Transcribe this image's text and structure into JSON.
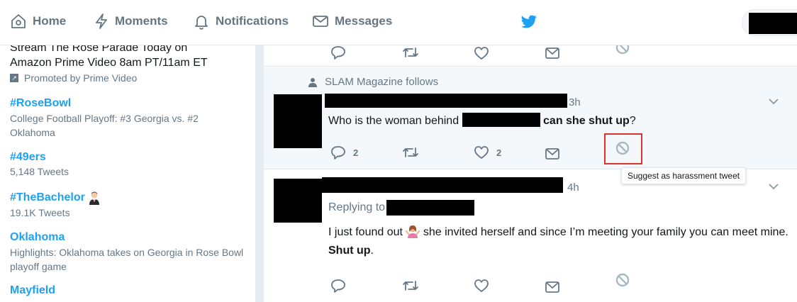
{
  "nav": {
    "home": "Home",
    "moments": "Moments",
    "notifications": "Notifications",
    "messages": "Messages",
    "brand_color": "#1da1f2"
  },
  "sidebar": {
    "promo": {
      "line1": "Stream The Rose Parade Today on",
      "line2": "Amazon Prime Video 8am PT/11am ET",
      "promoted_by": "Promoted by Prime Video"
    },
    "trends": [
      {
        "name": "#RoseBowl",
        "sub": "College Football Playoff: #3 Georgia vs. #2 Oklahoma"
      },
      {
        "name": "#49ers",
        "sub": "5,148 Tweets"
      },
      {
        "name": "#TheBachelor",
        "sub": "19.1K Tweets"
      },
      {
        "name": "Oklahoma",
        "sub": "Highlights: Oklahoma takes on Georgia in Rose Bowl playoff game"
      },
      {
        "name": "Mayfield",
        "sub": ""
      }
    ]
  },
  "feed": {
    "tweet2": {
      "social_context": "SLAM Magazine follows",
      "time": "3h",
      "text_before": "Who is the woman behind",
      "text_bold": "can she shut up",
      "text_after": "?",
      "reply_count": "2",
      "like_count": "2"
    },
    "tooltip": "Suggest as harassment tweet",
    "tweet3": {
      "time": "4h",
      "replying_to": "Replying to",
      "text_part1": "I just found out",
      "text_part2": "she invited herself and since I’m meeting your family you can meet mine.",
      "text_bold": "Shut up",
      "text_end": "."
    }
  }
}
